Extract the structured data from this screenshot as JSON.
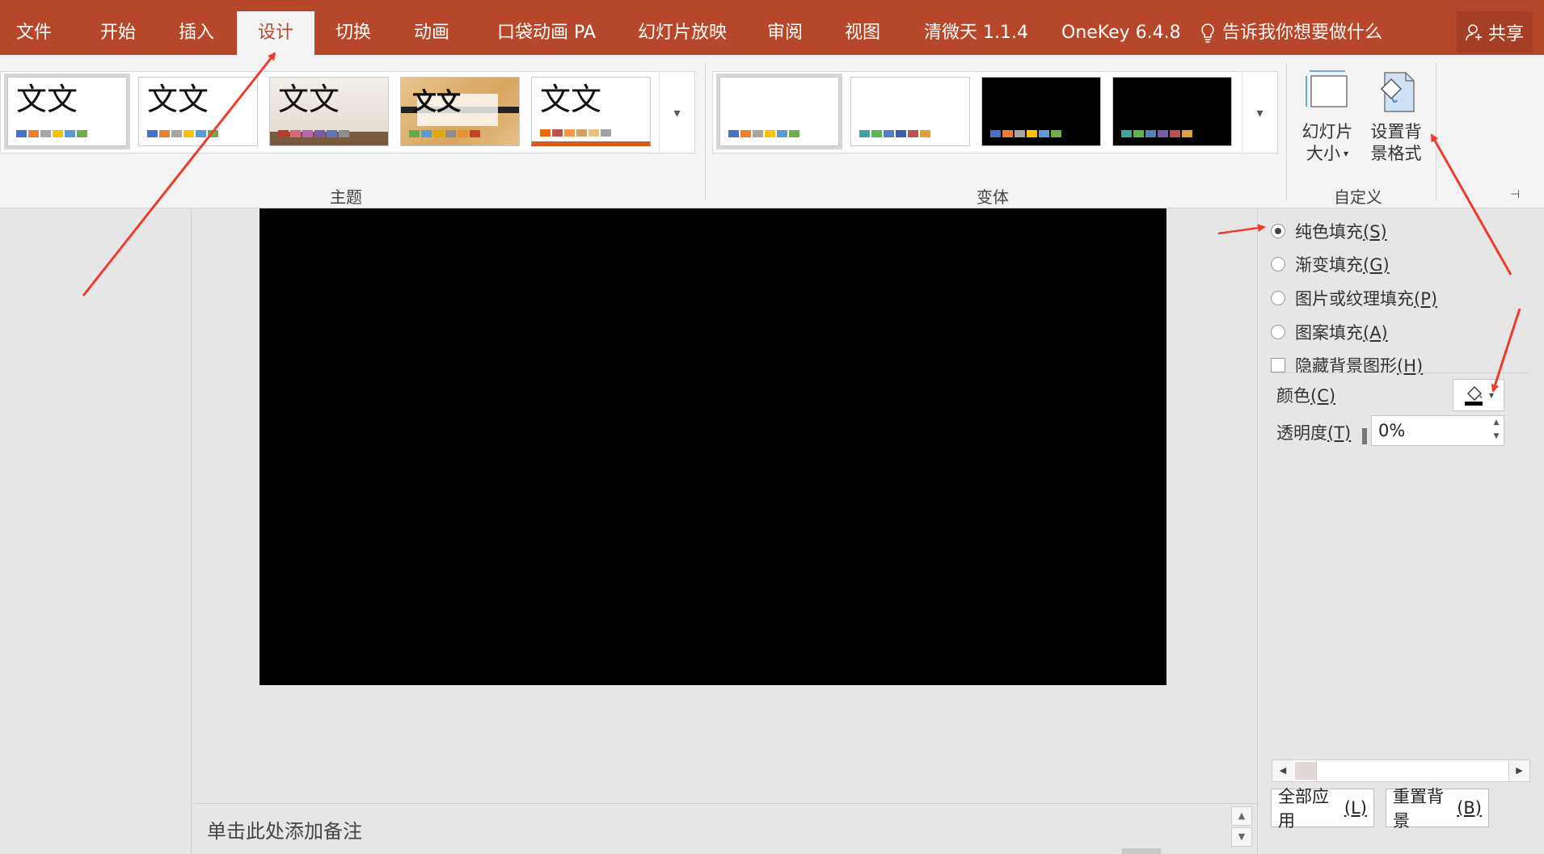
{
  "tabs": [
    {
      "label": "文件",
      "active": false
    },
    {
      "label": "开始",
      "active": false
    },
    {
      "label": "插入",
      "active": false
    },
    {
      "label": "设计",
      "active": true
    },
    {
      "label": "切换",
      "active": false
    },
    {
      "label": "动画",
      "active": false
    },
    {
      "label": "口袋动画 PA",
      "active": false
    },
    {
      "label": "幻灯片放映",
      "active": false
    },
    {
      "label": "审阅",
      "active": false
    },
    {
      "label": "视图",
      "active": false
    },
    {
      "label": "清微天 1.1.4",
      "active": false
    },
    {
      "label": "OneKey 6.4.8",
      "active": false
    }
  ],
  "tell_me": "告诉我你想要做什么",
  "share": "共享",
  "ribbon": {
    "themes_label": "主题",
    "variants_label": "变体",
    "custom_label": "自定义",
    "theme_thumb_text": "文文",
    "slide_size_line1": "幻灯片",
    "slide_size_line2": "大小",
    "format_bg_line1": "设置背",
    "format_bg_line2": "景格式"
  },
  "format_pane": {
    "fill_options": [
      {
        "label": "纯色填充",
        "key": "(S)",
        "selected": true
      },
      {
        "label": "渐变填充",
        "key": "(G)",
        "selected": false
      },
      {
        "label": "图片或纹理填充",
        "key": "(P)",
        "selected": false
      },
      {
        "label": "图案填充",
        "key": "(A)",
        "selected": false
      }
    ],
    "hide_bg_label": "隐藏背景图形",
    "hide_bg_key": "(H)",
    "color_label": "颜色",
    "color_key": "(C)",
    "transparency_label": "透明度",
    "transparency_key": "(T)",
    "transparency_value": "0%",
    "apply_all_label": "全部应用",
    "apply_all_key": "(L)",
    "reset_label": "重置背景",
    "reset_key": "(B)"
  },
  "notes_placeholder": "单击此处添加备注",
  "colors": {
    "accent": "#b7472a",
    "slide_bg": "#000000",
    "annotation_arrow": "#ef3b2c"
  }
}
